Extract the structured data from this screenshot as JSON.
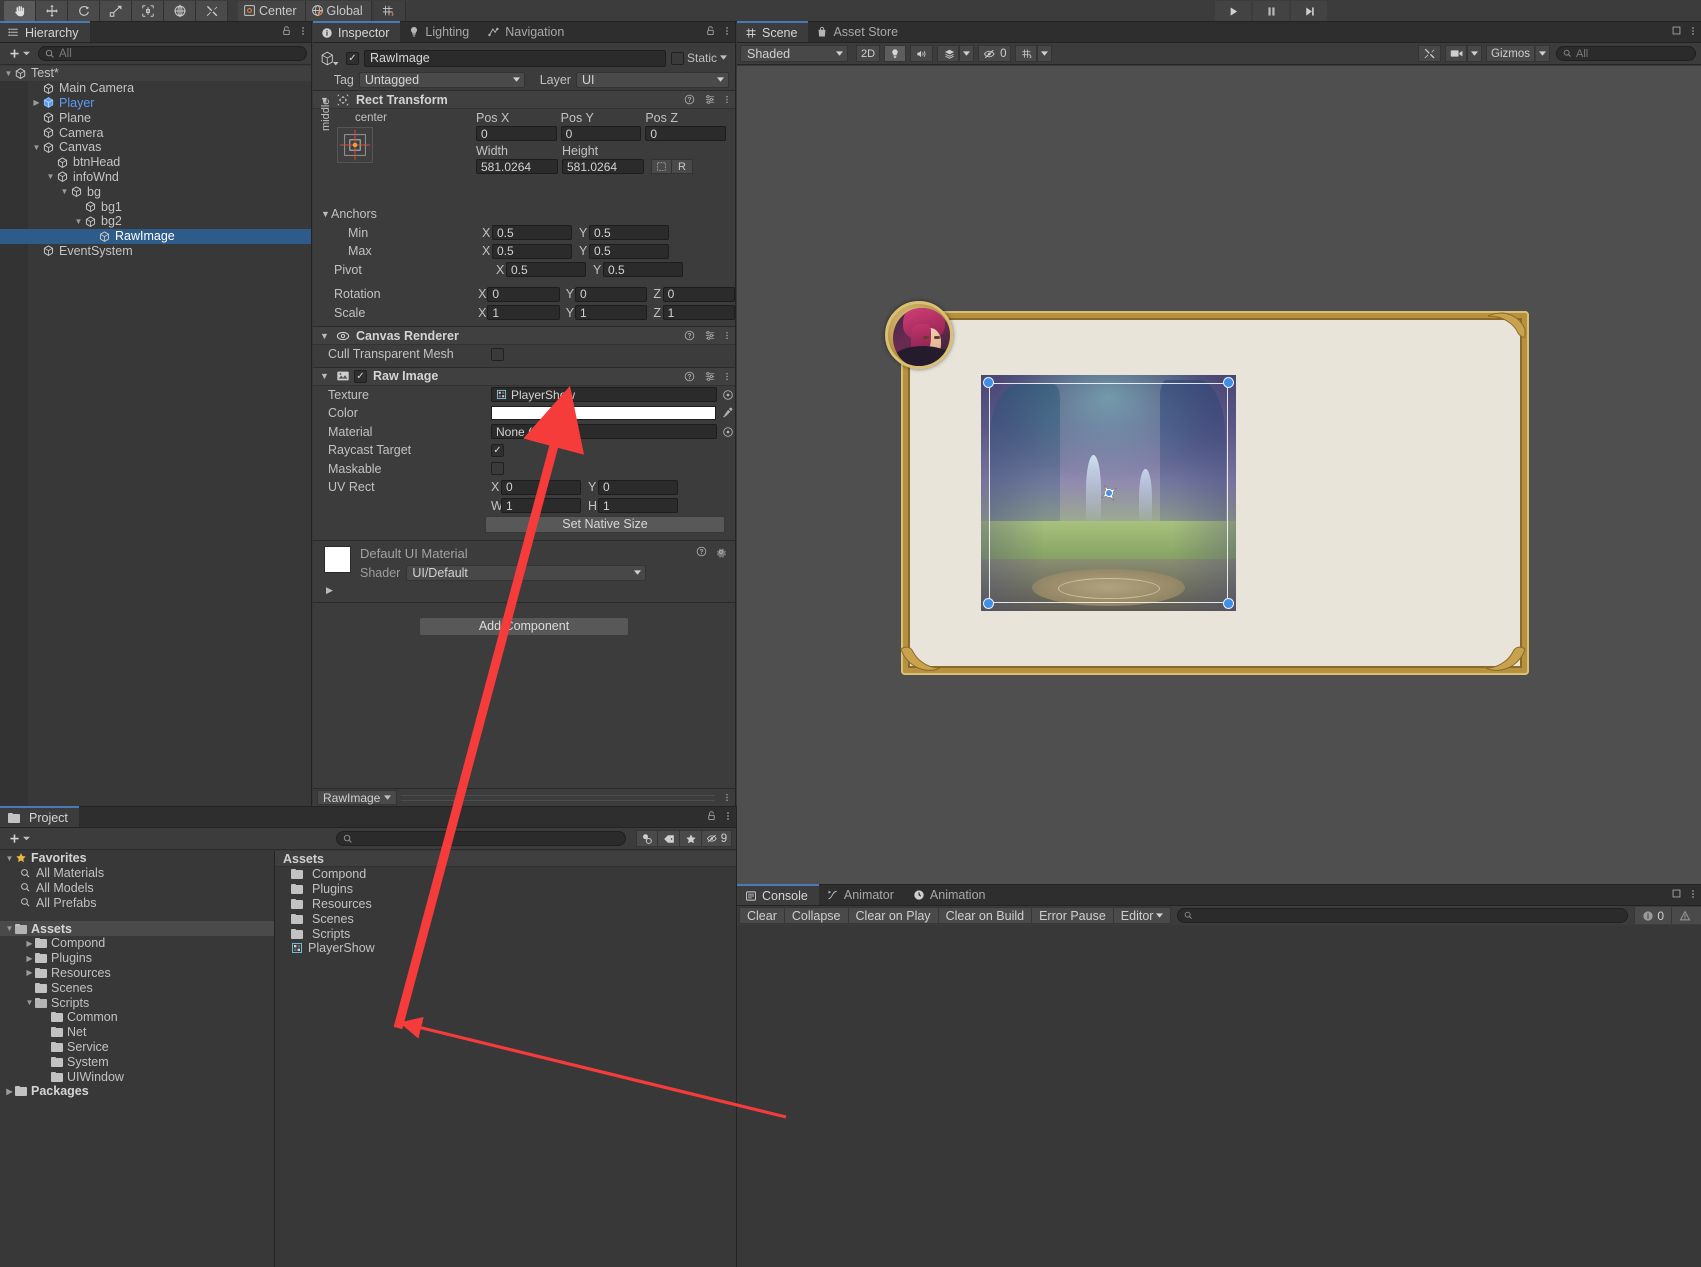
{
  "toolbar": {
    "tools": [
      "hand-tool",
      "move-tool",
      "rotate-tool",
      "scale-tool",
      "rect-tool",
      "transform-tool",
      "custom-tool"
    ],
    "pivot_mode": "Center",
    "pivot_rotation": "Global",
    "play": "play-button",
    "pause": "pause-button",
    "step": "step-button"
  },
  "hierarchy": {
    "tab": "Hierarchy",
    "search_placeholder": "All",
    "items": [
      {
        "label": "Test*",
        "depth": 0,
        "twirl": "down",
        "icon": "scene-icon",
        "selected": false,
        "root": true
      },
      {
        "label": "Main Camera",
        "depth": 2,
        "twirl": "",
        "icon": "gameobject-icon",
        "selected": false
      },
      {
        "label": "Player",
        "depth": 2,
        "twirl": "right",
        "icon": "prefab-icon",
        "selected": false,
        "prefab": true
      },
      {
        "label": "Plane",
        "depth": 2,
        "twirl": "",
        "icon": "gameobject-icon",
        "selected": false
      },
      {
        "label": "Camera",
        "depth": 2,
        "twirl": "",
        "icon": "gameobject-icon",
        "selected": false
      },
      {
        "label": "Canvas",
        "depth": 2,
        "twirl": "down",
        "icon": "gameobject-icon",
        "selected": false
      },
      {
        "label": "btnHead",
        "depth": 3,
        "twirl": "",
        "icon": "gameobject-icon",
        "selected": false
      },
      {
        "label": "infoWnd",
        "depth": 3,
        "twirl": "down",
        "icon": "gameobject-icon",
        "selected": false
      },
      {
        "label": "bg",
        "depth": 4,
        "twirl": "down",
        "icon": "gameobject-icon",
        "selected": false
      },
      {
        "label": "bg1",
        "depth": 5,
        "twirl": "",
        "icon": "gameobject-icon",
        "selected": false
      },
      {
        "label": "bg2",
        "depth": 5,
        "twirl": "down",
        "icon": "gameobject-icon",
        "selected": false
      },
      {
        "label": "RawImage",
        "depth": 6,
        "twirl": "",
        "icon": "gameobject-icon",
        "selected": true
      },
      {
        "label": "EventSystem",
        "depth": 2,
        "twirl": "",
        "icon": "gameobject-icon",
        "selected": false
      }
    ]
  },
  "inspector": {
    "tabs": [
      {
        "label": "Inspector",
        "icon": "info-icon",
        "selected": true
      },
      {
        "label": "Lighting",
        "icon": "light-bulb-icon",
        "selected": false
      },
      {
        "label": "Navigation",
        "icon": "navmesh-icon",
        "selected": false
      }
    ],
    "object_name": "RawImage",
    "enabled": true,
    "static_label": "Static",
    "tag_label": "Tag",
    "tag_value": "Untagged",
    "layer_label": "Layer",
    "layer_value": "UI",
    "rect_transform": {
      "title": "Rect Transform",
      "anchor_preset_top": "center",
      "anchor_preset_side": "middle",
      "pos_x_label": "Pos X",
      "pos_y_label": "Pos Y",
      "pos_z_label": "Pos Z",
      "pos_x": "0",
      "pos_y": "0",
      "pos_z": "0",
      "width_label": "Width",
      "height_label": "Height",
      "width": "581.0264",
      "height": "581.0264",
      "blueprint_label": "R",
      "anchors_label": "Anchors",
      "min_label": "Min",
      "min_x": "0.5",
      "min_y": "0.5",
      "max_label": "Max",
      "max_x": "0.5",
      "max_y": "0.5",
      "pivot_label": "Pivot",
      "pivot_x": "0.5",
      "pivot_y": "0.5",
      "rotation_label": "Rotation",
      "rot_x": "0",
      "rot_y": "0",
      "rot_z": "0",
      "scale_label": "Scale",
      "scale_x": "1",
      "scale_y": "1",
      "scale_z": "1"
    },
    "canvas_renderer": {
      "title": "Canvas Renderer",
      "cull_label": "Cull Transparent Mesh",
      "cull_checked": false
    },
    "raw_image": {
      "title": "Raw Image",
      "enabled": true,
      "texture_label": "Texture",
      "texture_value": "PlayerShow",
      "color_label": "Color",
      "color_value": "#FFFFFF",
      "material_label": "Material",
      "material_value": "None (Material)",
      "raycast_label": "Raycast Target",
      "raycast_checked": true,
      "maskable_label": "Maskable",
      "maskable_checked": false,
      "uvrect_label": "UV Rect",
      "uv_x": "0",
      "uv_y": "0",
      "uv_w": "1",
      "uv_h": "1",
      "set_native_size": "Set Native Size"
    },
    "material_block": {
      "title": "Default UI Material",
      "shader_label": "Shader",
      "shader_value": "UI/Default"
    },
    "add_component": "Add Component",
    "footer_object": "RawImage"
  },
  "scene": {
    "tabs": [
      {
        "label": "Scene",
        "icon": "grid-icon",
        "selected": true
      },
      {
        "label": "Asset Store",
        "icon": "store-bag-icon",
        "selected": false
      }
    ],
    "draw_mode": "Shaded",
    "mode_2d": "2D",
    "lighting_toggle": "light-bulb-icon",
    "audio_toggle": "audio-icon",
    "fx_toggle": "fx-icon",
    "hidden_count": "0",
    "grid_toggle": "grid-visibility-icon",
    "tools_icon": "tools-icon",
    "camera_icon": "scene-camera-icon",
    "gizmos_label": "Gizmos",
    "gizmos_search_placeholder": "All"
  },
  "project": {
    "tab": "Project",
    "search_placeholder": "",
    "hidden_count": "9",
    "favorites_label": "Favorites",
    "favorites": [
      {
        "label": "All Materials",
        "icon": "search-icon"
      },
      {
        "label": "All Models",
        "icon": "search-icon"
      },
      {
        "label": "All Prefabs",
        "icon": "search-icon"
      }
    ],
    "assets_label": "Assets",
    "tree": [
      {
        "label": "Compond",
        "depth": 1,
        "twirl": "right",
        "icon": "folder-icon"
      },
      {
        "label": "Plugins",
        "depth": 1,
        "twirl": "right",
        "icon": "folder-icon"
      },
      {
        "label": "Resources",
        "depth": 1,
        "twirl": "right",
        "icon": "folder-icon"
      },
      {
        "label": "Scenes",
        "depth": 1,
        "twirl": "",
        "icon": "folder-icon"
      },
      {
        "label": "Scripts",
        "depth": 1,
        "twirl": "down",
        "icon": "folder-open-icon"
      },
      {
        "label": "Common",
        "depth": 2,
        "twirl": "",
        "icon": "folder-icon"
      },
      {
        "label": "Net",
        "depth": 2,
        "twirl": "",
        "icon": "folder-icon"
      },
      {
        "label": "Service",
        "depth": 2,
        "twirl": "",
        "icon": "folder-icon"
      },
      {
        "label": "System",
        "depth": 2,
        "twirl": "",
        "icon": "folder-icon"
      },
      {
        "label": "UIWindow",
        "depth": 2,
        "twirl": "",
        "icon": "folder-icon"
      }
    ],
    "packages_label": "Packages",
    "content_header": "Assets",
    "contents": [
      {
        "label": "Compond",
        "icon": "folder-icon"
      },
      {
        "label": "Plugins",
        "icon": "folder-icon"
      },
      {
        "label": "Resources",
        "icon": "folder-icon"
      },
      {
        "label": "Scenes",
        "icon": "folder-icon"
      },
      {
        "label": "Scripts",
        "icon": "folder-icon"
      },
      {
        "label": "PlayerShow",
        "icon": "render-texture-icon"
      }
    ]
  },
  "console": {
    "tabs": [
      {
        "label": "Console",
        "icon": "console-icon",
        "selected": true
      },
      {
        "label": "Animator",
        "icon": "animator-icon",
        "selected": false
      },
      {
        "label": "Animation",
        "icon": "animation-icon",
        "selected": false
      }
    ],
    "buttons": [
      "Clear",
      "Collapse",
      "Clear on Play",
      "Clear on Build",
      "Error Pause"
    ],
    "editor_dropdown": "Editor",
    "search_placeholder": "",
    "log_count": "0",
    "warn_count": "",
    "error_count": ""
  },
  "colors": {
    "selection_blue": "#2d5c8a",
    "accent_blue": "#4a79b8",
    "annotation_red": "#f63b3b",
    "panel_bg": "#383838",
    "toolbar_bg": "#3c3c3c"
  }
}
